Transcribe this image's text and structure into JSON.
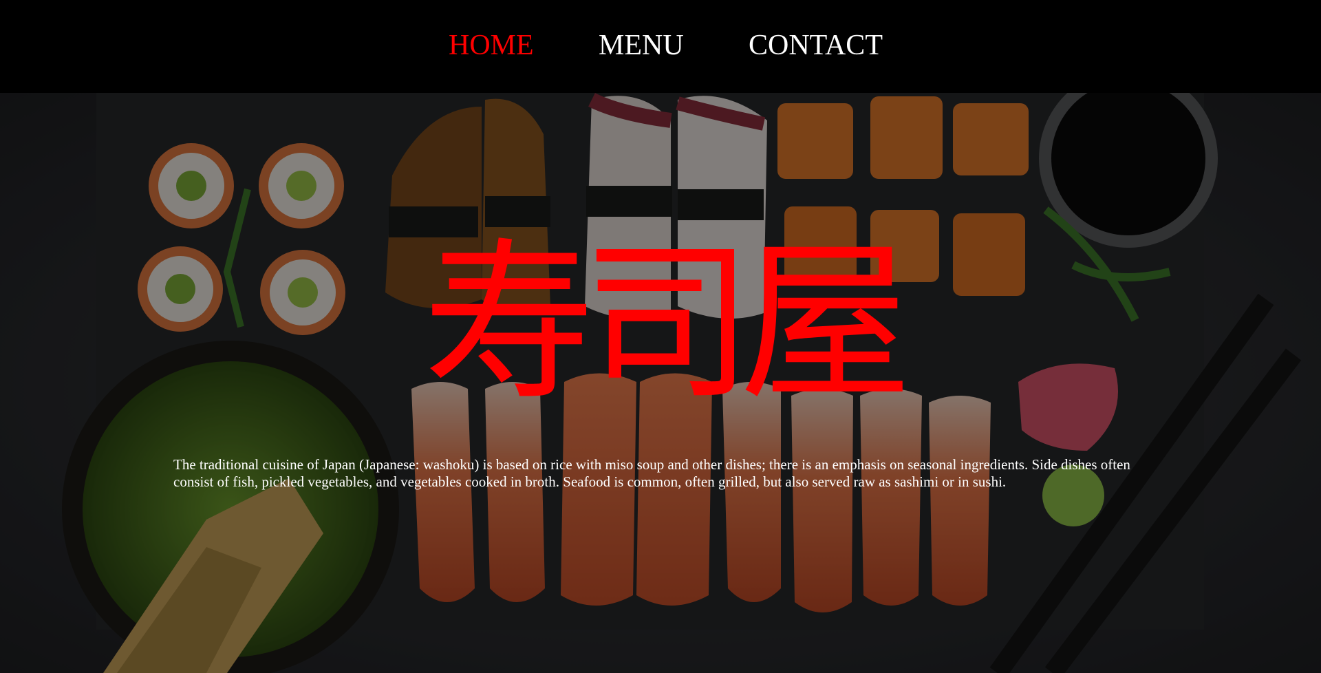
{
  "nav": {
    "home": "HOME",
    "menu": "MENU",
    "contact": "CONTACT"
  },
  "hero": {
    "title": "寿司屋",
    "description": "The traditional cuisine of Japan (Japanese: washoku) is based on rice with miso soup and other dishes; there is an emphasis on seasonal ingredients. Side dishes often consist of fish, pickled vegetables, and vegetables cooked in broth. Seafood is common, often grilled, but also served raw as sashimi or in sushi."
  },
  "colors": {
    "background": "#000000",
    "nav_text": "#ffffff",
    "nav_active": "#ff0000",
    "title": "#ff0000"
  }
}
